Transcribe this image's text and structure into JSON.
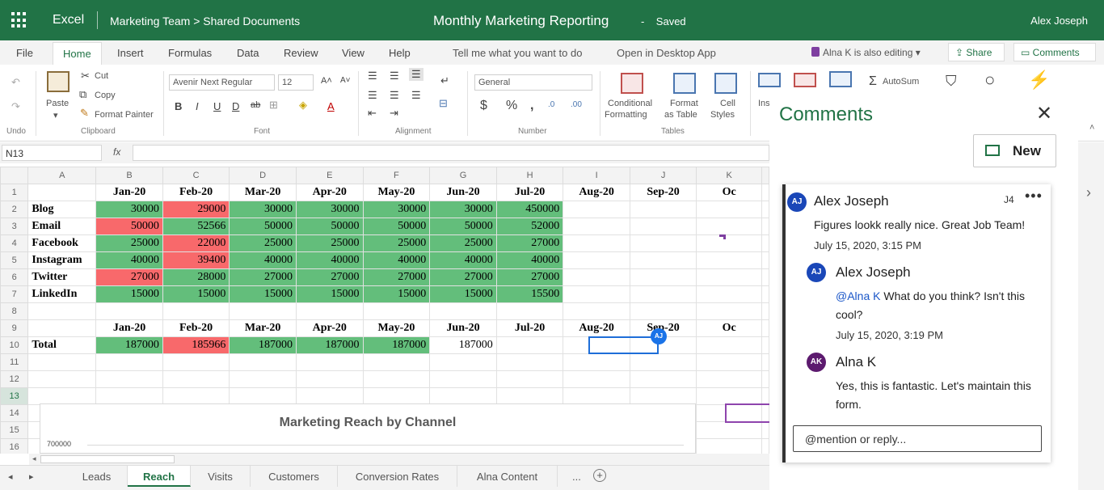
{
  "titlebar": {
    "app": "Excel",
    "breadcrumb": "Marketing Team > Shared Documents",
    "document": "Monthly Marketing Reporting",
    "dash": "-",
    "status": "Saved",
    "user": "Alex Joseph"
  },
  "menu": {
    "tabs": [
      "File",
      "Home",
      "Insert",
      "Formulas",
      "Data",
      "Review",
      "View",
      "Help"
    ],
    "tellme": "Tell me what you want to do",
    "open_desktop": "Open in Desktop App",
    "editing": "Alna K is also editing",
    "share": "Share",
    "comments": "Comments"
  },
  "ribbon": {
    "undo": "Undo",
    "paste": "Paste",
    "cut": "Cut",
    "copy": "Copy",
    "format_painter": "Format Painter",
    "clipboard": "Clipboard",
    "font_name": "Avenir Next Regular",
    "font_size": "12",
    "font": "Font",
    "alignment": "Alignment",
    "number_format": "General",
    "number": "Number",
    "conditional_formatting_1": "Conditional",
    "conditional_formatting_2": "Formatting",
    "format_as_table_1": "Format",
    "format_as_table_2": "as Table",
    "cell_styles_1": "Cell",
    "cell_styles_2": "Styles",
    "tables": "Tables",
    "insert_partial": "Ins",
    "autosum": "AutoSum"
  },
  "formula_bar": {
    "name_box": "N13",
    "fx": "fx"
  },
  "grid": {
    "columns": [
      "A",
      "B",
      "C",
      "D",
      "E",
      "F",
      "G",
      "H",
      "I",
      "J",
      "K"
    ],
    "row_numbers": [
      "1",
      "2",
      "3",
      "4",
      "5",
      "6",
      "7",
      "8",
      "9",
      "10",
      "11",
      "12",
      "13",
      "14",
      "15",
      "16"
    ],
    "months_top": [
      "Jan-20",
      "Feb-20",
      "Mar-20",
      "Apr-20",
      "May-20",
      "Jun-20",
      "Jul-20",
      "Aug-20",
      "Sep-20",
      "Oc"
    ],
    "channels": [
      {
        "name": "Blog",
        "values": [
          "30000",
          "29000",
          "30000",
          "30000",
          "30000",
          "30000",
          "450000"
        ]
      },
      {
        "name": "Email",
        "values": [
          "50000",
          "52566",
          "50000",
          "50000",
          "50000",
          "50000",
          "52000"
        ]
      },
      {
        "name": "Facebook",
        "values": [
          "25000",
          "22000",
          "25000",
          "25000",
          "25000",
          "25000",
          "27000"
        ]
      },
      {
        "name": "Instagram",
        "values": [
          "40000",
          "39400",
          "40000",
          "40000",
          "40000",
          "40000",
          "40000"
        ]
      },
      {
        "name": "Twitter",
        "values": [
          "27000",
          "28000",
          "27000",
          "27000",
          "27000",
          "27000",
          "27000"
        ]
      },
      {
        "name": "LinkedIn",
        "values": [
          "15000",
          "15000",
          "15000",
          "15000",
          "15000",
          "15000",
          "15500"
        ]
      }
    ],
    "cell_colors": [
      [
        "#63be7b",
        "#f8696b",
        "#63be7b",
        "#63be7b",
        "#63be7b",
        "#63be7b",
        "#63be7b"
      ],
      [
        "#f8696b",
        "#63be7b",
        "#63be7b",
        "#63be7b",
        "#63be7b",
        "#63be7b",
        "#63be7b"
      ],
      [
        "#63be7b",
        "#f8696b",
        "#63be7b",
        "#63be7b",
        "#63be7b",
        "#63be7b",
        "#63be7b"
      ],
      [
        "#63be7b",
        "#f8696b",
        "#63be7b",
        "#63be7b",
        "#63be7b",
        "#63be7b",
        "#63be7b"
      ],
      [
        "#f8696b",
        "#63be7b",
        "#63be7b",
        "#63be7b",
        "#63be7b",
        "#63be7b",
        "#63be7b"
      ],
      [
        "#63be7b",
        "#63be7b",
        "#63be7b",
        "#63be7b",
        "#63be7b",
        "#63be7b",
        "#63be7b"
      ]
    ],
    "months_total": [
      "Jan-20",
      "Feb-20",
      "Mar-20",
      "Apr-20",
      "May-20",
      "Jun-20",
      "Jul-20",
      "Aug-20",
      "Sep-20",
      "Oc"
    ],
    "total_label": "Total",
    "totals": [
      "187000",
      "185966",
      "187000",
      "187000",
      "187000",
      "187000"
    ],
    "total_colors": [
      "#63be7b",
      "#f8696b",
      "#63be7b",
      "#63be7b",
      "#63be7b",
      ""
    ],
    "selection_marker": "AJ"
  },
  "chart": {
    "title": "Marketing Reach by Channel",
    "ytick": "700000"
  },
  "sheets": {
    "tabs": [
      "Leads",
      "Reach",
      "Visits",
      "Customers",
      "Conversion Rates",
      "Alna Content"
    ],
    "active": "Reach",
    "more": "..."
  },
  "comments_pane": {
    "title": "Comments",
    "new_button": "New",
    "cell_ref": "J4",
    "comments": [
      {
        "initials": "AJ",
        "author": "Alex Joseph",
        "avatar_color": "#1a47b8",
        "text": "Figures lookk really nice. Great Job Team!",
        "date": "July 15, 2020, 3:15 PM"
      },
      {
        "initials": "AJ",
        "author": "Alex Joseph",
        "avatar_color": "#1a47b8",
        "mention": "@Alna K",
        "text_line1": " What do you think? Isn't this",
        "text_line2": "cool?",
        "date": "July 15, 2020, 3:19 PM"
      },
      {
        "initials": "AK",
        "author": "Alna K",
        "avatar_color": "#5c1a6e",
        "text_line1": "Yes, this is fantastic. Let's maintain this",
        "text_line2": "form."
      }
    ],
    "reply_placeholder": "@mention or reply..."
  }
}
